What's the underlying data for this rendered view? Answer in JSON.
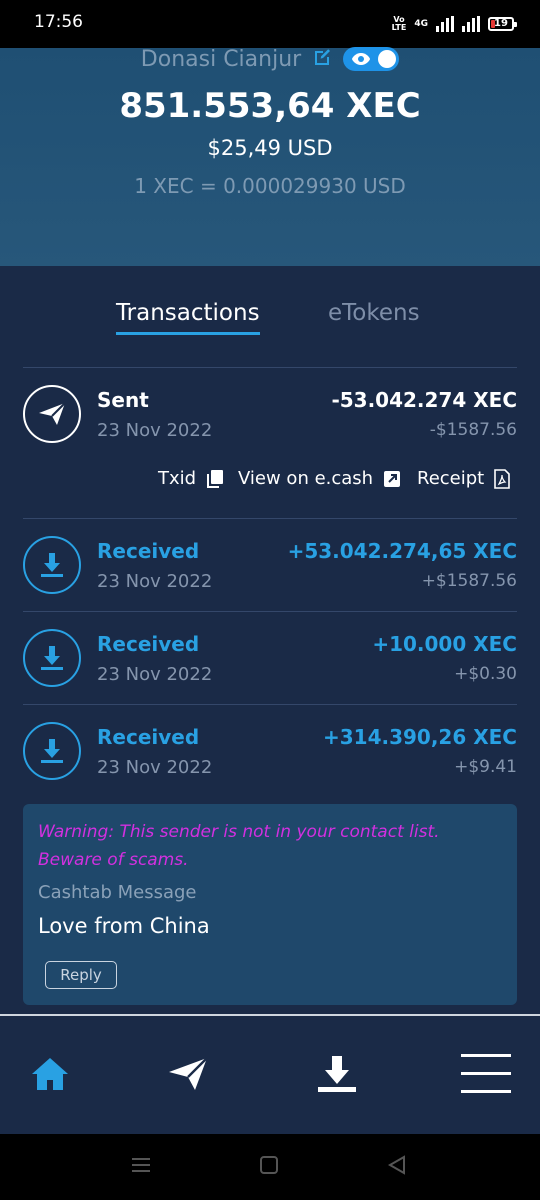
{
  "status": {
    "time": "17:56",
    "volte": [
      "Vo",
      "LTE",
      "B"
    ],
    "network": "4G",
    "battery": "19"
  },
  "wallet": {
    "name": "Donasi Cianjur",
    "balance_xec": "851.553,64 XEC",
    "balance_usd": "$25,49 USD",
    "rate": "1 XEC = 0.000029930 USD"
  },
  "tabs": [
    {
      "label": "Transactions",
      "active": true
    },
    {
      "label": "eTokens",
      "active": false
    }
  ],
  "transactions": [
    {
      "type": "Sent",
      "date": "23 Nov 2022",
      "amount": "-53.042.274 XEC",
      "fiat": "-$1587.56",
      "icon": "send-icon"
    },
    {
      "type": "Received",
      "date": "23 Nov 2022",
      "amount": "+53.042.274,65 XEC",
      "fiat": "+$1587.56",
      "icon": "download-icon"
    },
    {
      "type": "Received",
      "date": "23 Nov 2022",
      "amount": "+10.000 XEC",
      "fiat": "+$0.30",
      "icon": "download-icon"
    },
    {
      "type": "Received",
      "date": "23 Nov 2022",
      "amount": "+314.390,26 XEC",
      "fiat": "+$9.41",
      "icon": "download-icon"
    }
  ],
  "tx_actions": {
    "txid": "Txid",
    "view": "View on e.cash",
    "receipt": "Receipt"
  },
  "message": {
    "warning": "Warning: This sender is not in your contact list. Beware of scams.",
    "label": "Cashtab Message",
    "text": "Love from China",
    "reply": "Reply"
  },
  "nav": [
    "home-icon",
    "send-icon",
    "receive-icon",
    "menu-icon"
  ],
  "colors": {
    "accent": "#29a1e3",
    "warning": "#d230e0",
    "background": "#1a2a47",
    "header": "#27577a"
  }
}
